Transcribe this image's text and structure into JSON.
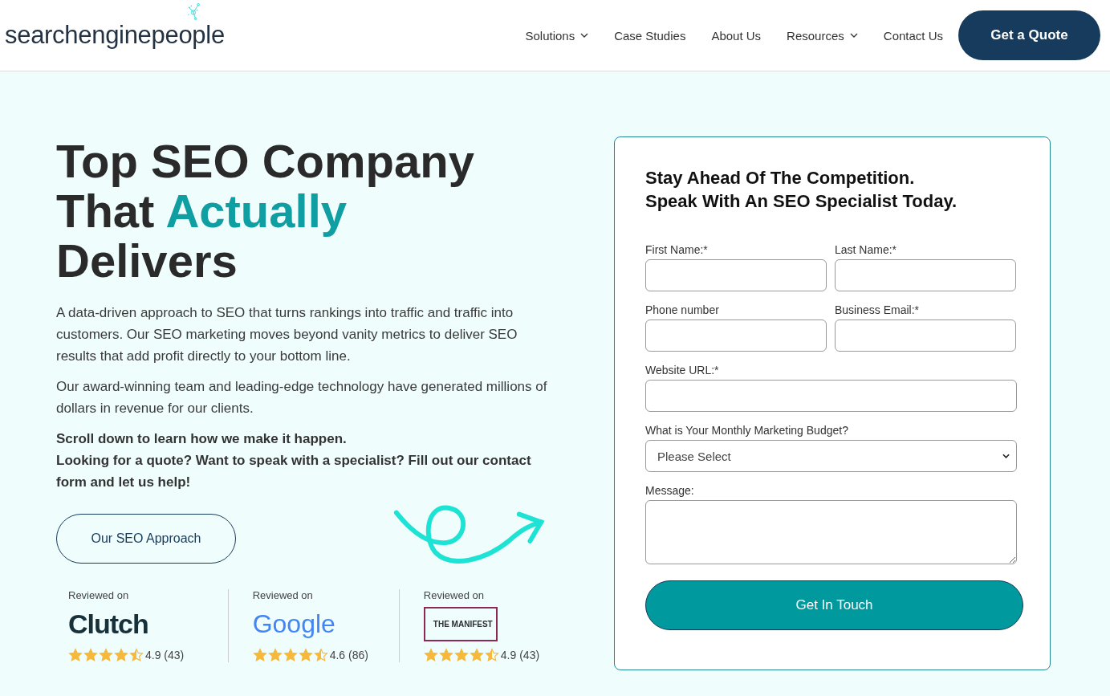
{
  "header": {
    "logo": "searchenginepeople",
    "nav": [
      {
        "label": "Solutions",
        "dropdown": true
      },
      {
        "label": "Case Studies",
        "dropdown": false
      },
      {
        "label": "About Us",
        "dropdown": false
      },
      {
        "label": "Resources",
        "dropdown": true
      },
      {
        "label": "Contact Us",
        "dropdown": false
      }
    ],
    "cta": "Get a Quote"
  },
  "hero": {
    "headline": [
      {
        "text": "Top SEO Company That ",
        "highlight": false
      },
      {
        "text": "Actually",
        "highlight": true
      },
      {
        "text": " Delivers",
        "highlight": false
      }
    ],
    "paragraphs": [
      {
        "text": "A data-driven approach to SEO that turns rankings into traffic and traffic into customers. Our SEO marketing moves beyond vanity metrics to deliver SEO results that add profit directly to your bottom line.",
        "bold": false
      },
      {
        "text": "Our award-winning team and leading-edge technology have generated millions of dollars in revenue for our clients.",
        "bold": false
      },
      {
        "text": "Scroll down to learn how we make it happen.",
        "bold": true
      },
      {
        "text": "Looking for a quote? Want to speak with a specialist? Fill out our contact form and let us help!",
        "bold": true
      }
    ],
    "button": "Our SEO Approach",
    "reviews": [
      {
        "label": "Reviewed on",
        "brand": "Clutch",
        "kind": "clutch",
        "stars": 4.5,
        "rating": "4.9 (43)"
      },
      {
        "label": "Reviewed on",
        "brand": "Google",
        "kind": "google",
        "stars": 4.5,
        "rating": "4.6 (86)"
      },
      {
        "label": "Reviewed on",
        "brand": "THE MANIFEST",
        "kind": "manifest",
        "stars": 4.5,
        "rating": "4.9 (43)"
      }
    ]
  },
  "form": {
    "title_lines": [
      "Stay Ahead Of The Competition.",
      "Speak With An SEO Specialist Today."
    ],
    "fields": [
      {
        "label": "First Name:*",
        "kind": "input",
        "half": true
      },
      {
        "label": "Last Name:*",
        "kind": "input",
        "half": true
      },
      {
        "label": "Phone number",
        "kind": "input",
        "half": true
      },
      {
        "label": "Business Email:*",
        "kind": "input",
        "half": true
      },
      {
        "label": "Website URL:*",
        "kind": "input",
        "half": false
      },
      {
        "label": "What is Your Monthly Marketing Budget?",
        "kind": "select",
        "value": "Please Select",
        "half": false
      },
      {
        "label": "Message:",
        "kind": "textarea",
        "half": false
      }
    ],
    "submit": "Get In Touch"
  }
}
